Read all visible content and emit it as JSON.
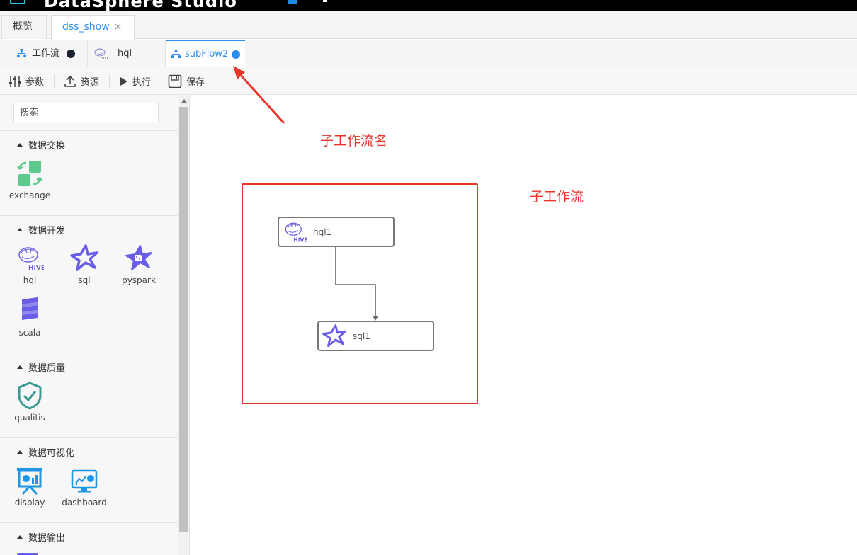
{
  "header": {
    "brand": "DataSphere Studio"
  },
  "project_tabs": [
    {
      "label": "概览"
    },
    {
      "label": "dss_show",
      "close": "×"
    }
  ],
  "workflow_tabs": [
    {
      "label": "工作流",
      "icon": "tree-icon",
      "status": "dark-dot"
    },
    {
      "label": "hql",
      "icon": "hive-icon"
    },
    {
      "label": "subFlow2",
      "icon": "tree-icon",
      "status": "blue-dot",
      "active": true
    }
  ],
  "toolbar": {
    "params": "参数",
    "resources": "资源",
    "run": "执行",
    "save": "保存"
  },
  "sidebar": {
    "search_placeholder": "搜索",
    "sections": [
      {
        "title": "数据交换",
        "nodes": [
          {
            "label": "exchange",
            "icon": "exchange-icon"
          }
        ]
      },
      {
        "title": "数据开发",
        "nodes": [
          {
            "label": "hql",
            "icon": "hive-icon"
          },
          {
            "label": "sql",
            "icon": "spark-star-icon"
          },
          {
            "label": "pyspark",
            "icon": "pyspark-icon"
          },
          {
            "label": "scala",
            "icon": "scala-icon"
          }
        ]
      },
      {
        "title": "数据质量",
        "nodes": [
          {
            "label": "qualitis",
            "icon": "shield-check-icon"
          }
        ]
      },
      {
        "title": "数据可视化",
        "nodes": [
          {
            "label": "display",
            "icon": "display-icon"
          },
          {
            "label": "dashboard",
            "icon": "dashboard-icon"
          }
        ]
      },
      {
        "title": "数据输出",
        "nodes": []
      }
    ]
  },
  "canvas": {
    "annotation_tab": "子工作流名",
    "annotation_box": "子工作流",
    "nodes": [
      {
        "label": "hql1",
        "icon": "hive-icon"
      },
      {
        "label": "sql1",
        "icon": "spark-star-icon"
      }
    ]
  },
  "colors": {
    "accent": "#2d8cf0",
    "annotation": "#e8342b",
    "node_purple": "#6a5ee8",
    "exchange_green": "#5dc98c",
    "qualitis_teal": "#3a9a94",
    "display_blue": "#1e96e8"
  }
}
